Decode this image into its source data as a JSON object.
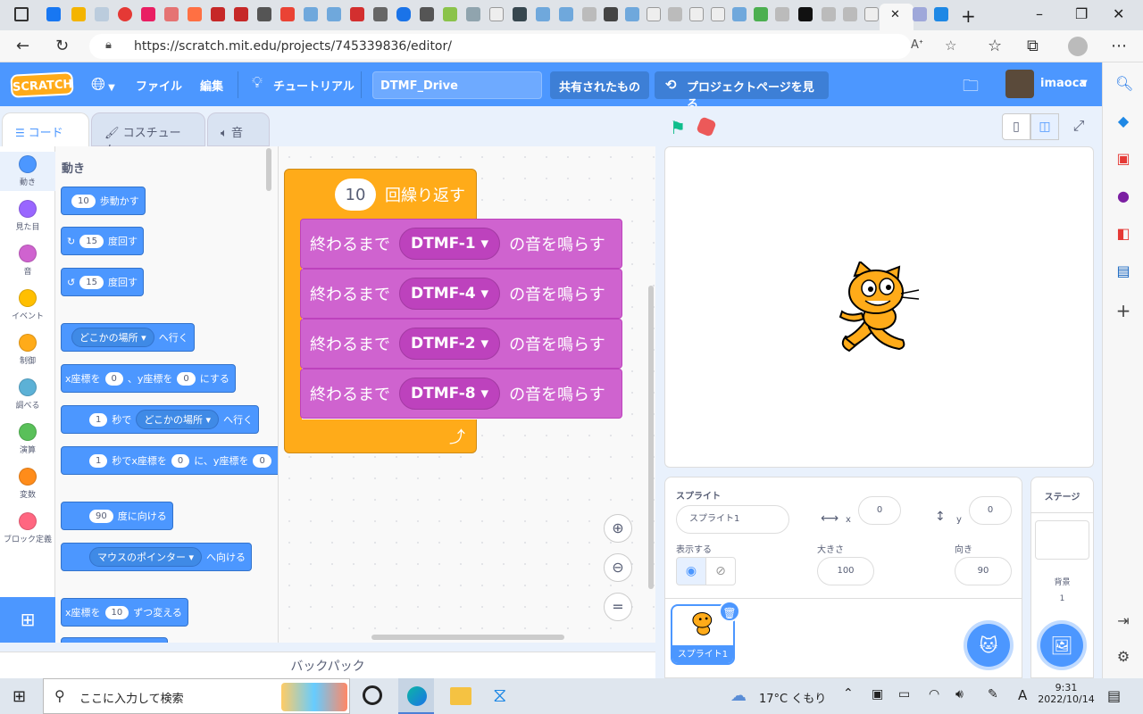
{
  "browser": {
    "url": "https://scratch.mit.edu/projects/745339836/editor/",
    "tab_close": "✕"
  },
  "menu": {
    "logo": "SCRATCH",
    "file": "ファイル",
    "edit": "編集",
    "tutorial": "チュートリアル",
    "project_title": "DTMF_Drive",
    "shared": "共有されたもの",
    "project_page": "プロジェクトページを見る",
    "username": "imaoca"
  },
  "tabs": {
    "code": "コード",
    "costumes": "コスチューム",
    "sounds": "音"
  },
  "categories": [
    {
      "label": "動き",
      "color": "#4c97ff"
    },
    {
      "label": "見た目",
      "color": "#9966ff"
    },
    {
      "label": "音",
      "color": "#cf63cf"
    },
    {
      "label": "イベント",
      "color": "#ffbf00"
    },
    {
      "label": "制御",
      "color": "#ffab19"
    },
    {
      "label": "調べる",
      "color": "#5cb1d6"
    },
    {
      "label": "演算",
      "color": "#59c059"
    },
    {
      "label": "変数",
      "color": "#ff8c1a"
    },
    {
      "label": "ブロック定義",
      "color": "#ff6680"
    }
  ],
  "palette": {
    "heading": "動き",
    "move_steps": "10",
    "move_label": "歩動かす",
    "turn_right": "15",
    "turn_label": "度回す",
    "turn_left": "15",
    "turn_label2": "度回す",
    "goto_target": "どこかの場所",
    "goto_label": "へ行く",
    "setxy_x_label": "x座標を",
    "setxy_x": "0",
    "setxy_y_label": "、y座標を",
    "setxy_y": "0",
    "setxy_end": "にする",
    "glide_secs": "1",
    "glide_label": "秒で",
    "glide_target": "どこかの場所",
    "glide_end": "へ行く",
    "glidexy_secs": "1",
    "glidexy_label": "秒でx座標を",
    "glidexy_x": "0",
    "glidexy_mid": "に、y座標を",
    "glidexy_y": "0",
    "point_dir": "90",
    "point_label": "度に向ける",
    "pointto_target": "マウスのポインター",
    "pointto_label": "へ向ける",
    "changex_label": "x座標を",
    "changex_val": "10",
    "changex_end": "ずつ変える"
  },
  "script": {
    "repeat_count": "10",
    "repeat_label": "回繰り返す",
    "sound_prefix": "終わるまで",
    "sound_suffix": "の音を鳴らす",
    "sounds": [
      "DTMF-1",
      "DTMF-4",
      "DTMF-2",
      "DTMF-8"
    ]
  },
  "backpack": "バックパック",
  "sprite": {
    "heading": "スプライト",
    "name": "スプライト1",
    "x_label": "x",
    "x": "0",
    "y_label": "y",
    "y": "0",
    "show_label": "表示する",
    "size_label": "大きさ",
    "size": "100",
    "direction_label": "向き",
    "direction": "90",
    "thumb_name": "スプライト1"
  },
  "stage_panel": {
    "heading": "ステージ",
    "backdrops_label": "背景",
    "backdrops_count": "1"
  },
  "taskbar": {
    "search_placeholder": "ここに入力して検索",
    "weather": "17°C くもり",
    "ime": "A",
    "time": "9:31",
    "date": "2022/10/14"
  },
  "colors": {
    "scratch_blue": "#4c97ff",
    "control_orange": "#ffab19",
    "sound_purple": "#cf63cf"
  }
}
